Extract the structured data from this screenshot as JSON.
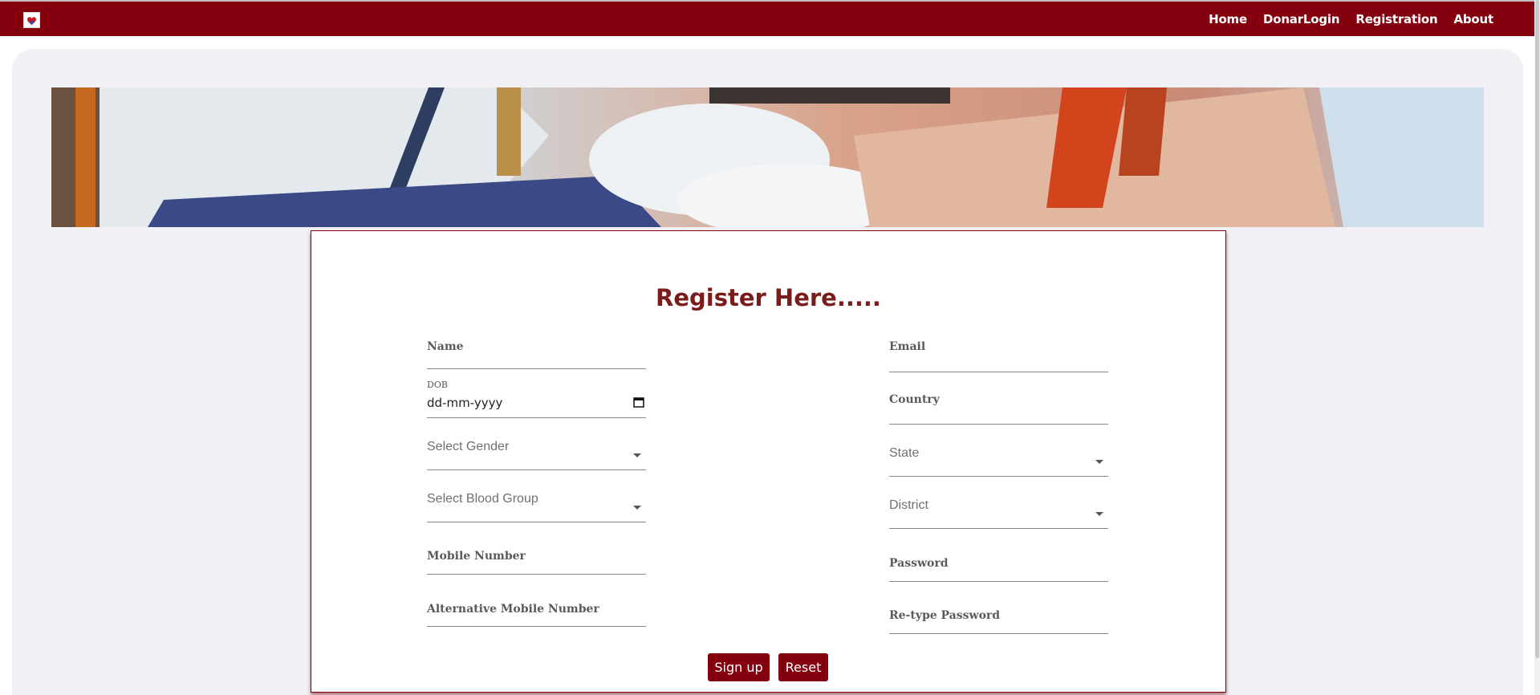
{
  "navbar": {
    "logo_icon": "blood-donation-logo-icon",
    "links": [
      "Home",
      "DonarLogin",
      "Registration",
      "About"
    ],
    "background": "#85000e"
  },
  "hero": {
    "image": "blood-donation-photo"
  },
  "form": {
    "title": "Register Here.....",
    "left": {
      "name_label": "Name",
      "dob_label": "DOB",
      "dob_value": "dd-mm-yyyy",
      "gender_placeholder": "Select Gender",
      "blood_group_placeholder": "Select Blood Group",
      "mobile_label": "Mobile Number",
      "alt_mobile_label": "Alternative Mobile Number"
    },
    "right": {
      "email_label": "Email",
      "country_label": "Country",
      "state_placeholder": "State",
      "district_placeholder": "District",
      "password_label": "Password",
      "retype_password_label": "Re-type Password"
    },
    "buttons": {
      "signup": "Sign up",
      "reset": "Reset"
    },
    "accent": "#85000e",
    "title_color": "#7a1c1c"
  }
}
